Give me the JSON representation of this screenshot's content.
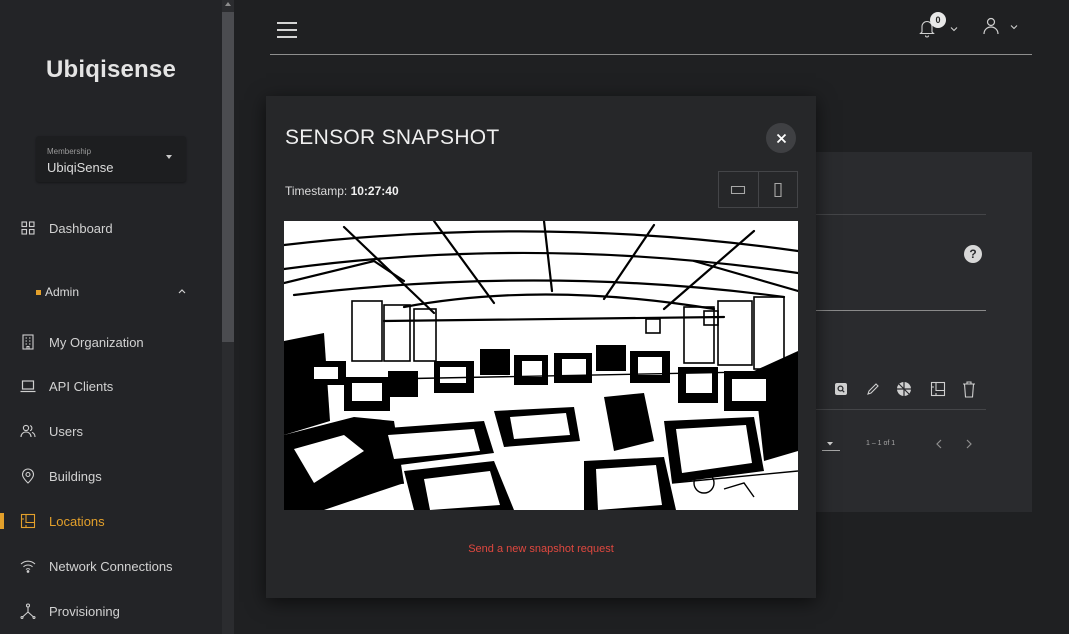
{
  "sidebar": {
    "brand": "Ubiqisense",
    "membership": {
      "caption": "Membership",
      "value": "UbiqiSense"
    },
    "dashboard": "Dashboard",
    "section": "Admin",
    "items": [
      {
        "label": "My Organization",
        "icon": "building-icon"
      },
      {
        "label": "API Clients",
        "icon": "laptop-icon"
      },
      {
        "label": "Users",
        "icon": "users-icon"
      },
      {
        "label": "Buildings",
        "icon": "map-pin-icon"
      },
      {
        "label": "Locations",
        "icon": "floorplan-icon",
        "active": true
      },
      {
        "label": "Network Connections",
        "icon": "wifi-icon"
      },
      {
        "label": "Provisioning",
        "icon": "network-icon"
      }
    ]
  },
  "header": {
    "notification_count": "0"
  },
  "background_card": {
    "help": "?",
    "pagination": "1 – 1 of 1"
  },
  "modal": {
    "title": "SENSOR SNAPSHOT",
    "timestamp_label": "Timestamp:",
    "timestamp_value": "10:27:40",
    "send_link": "Send a new snapshot request"
  },
  "colors": {
    "accent": "#e3a02b",
    "link": "#e0483f",
    "background": "#1f2022"
  }
}
